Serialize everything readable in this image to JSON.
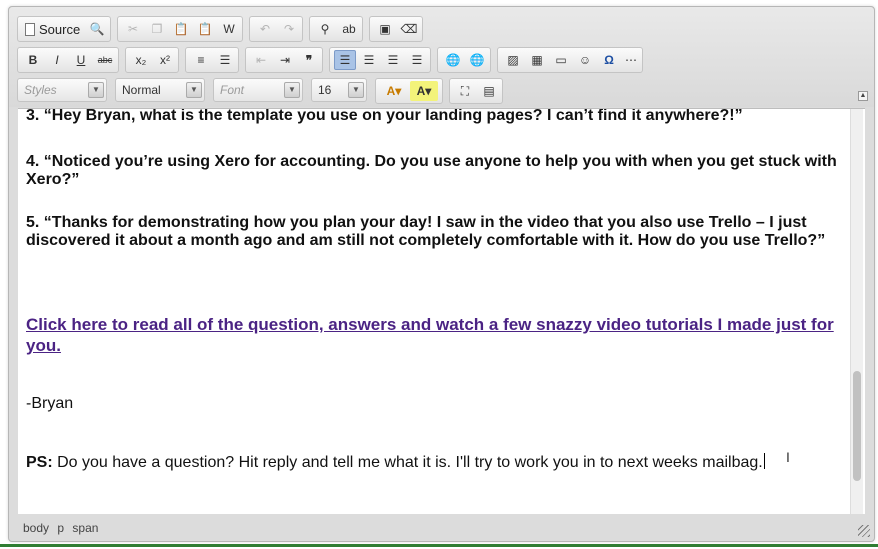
{
  "toolbar": {
    "source_label": "Source",
    "styles_placeholder": "Styles",
    "format_value": "Normal",
    "font_placeholder": "Font",
    "size_value": "16"
  },
  "content": {
    "q3": "3.  “Hey Bryan, what is the template you use on your landing pages? I can’t find it anywhere?!”",
    "q4": "4. “Noticed you’re using Xero for accounting. Do you use anyone to help you with when you get stuck with Xero?”",
    "q5": "5. “Thanks for demonstrating how you plan your day! I saw in the video that you also use Trello – I just discovered it about a month ago and am still not completely comfortable with it. How do you use Trello?”",
    "link": "Click here to read all of the question, answers and watch a few snazzy video tutorials I made just for you.",
    "signoff": "-Bryan",
    "ps_label": "PS:",
    "ps_text": " Do you have a question? Hit reply and tell me what it is. I'll try to work you in to next weeks mailbag."
  },
  "statusbar": {
    "path": [
      "body",
      "p",
      "span"
    ]
  },
  "colors": {
    "link": "#4b2384",
    "active_button": "#a9c3e6",
    "bottom_rule": "#2f7d32"
  }
}
